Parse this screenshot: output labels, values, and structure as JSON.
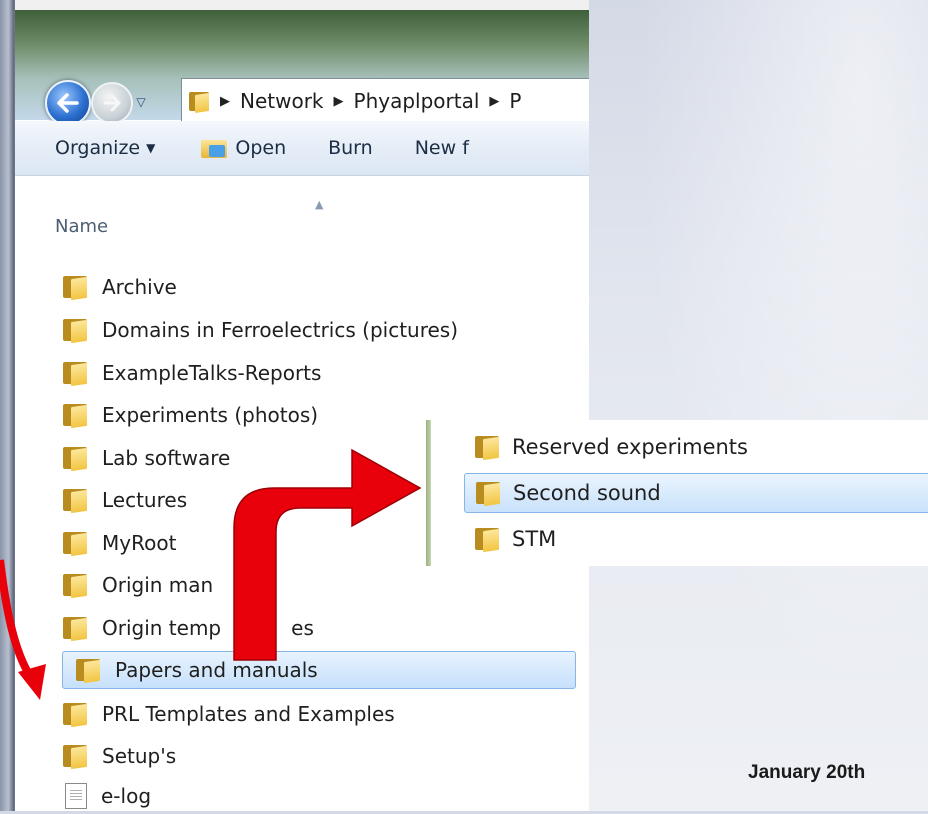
{
  "address_bar": {
    "crumbs": [
      "Network",
      "Phyaplportal",
      "P"
    ]
  },
  "toolbar": {
    "organize_label": "Organize",
    "open_label": "Open",
    "burn_label": "Burn",
    "new_label": "New f"
  },
  "column_header": {
    "name_label": "Name"
  },
  "file_list": [
    {
      "label": "Archive",
      "icon": "folder-icon"
    },
    {
      "label": "Domains in Ferroelectrics (pictures)",
      "icon": "folder-icon"
    },
    {
      "label": "ExampleTalks-Reports",
      "icon": "folder-icon"
    },
    {
      "label": "Experiments (photos)",
      "icon": "folder-icon"
    },
    {
      "label": "Lab software",
      "icon": "folder-icon"
    },
    {
      "label": "Lectures",
      "icon": "folder-icon"
    },
    {
      "label": "MyRoot",
      "icon": "folder-icon"
    },
    {
      "label": "Origin man",
      "icon": "folder-icon"
    },
    {
      "label": "Origin temp",
      "icon": "folder-icon",
      "suffix": "es"
    },
    {
      "label": "Papers and manuals",
      "icon": "folder-icon",
      "selected": true
    },
    {
      "label": "PRL Templates and Examples",
      "icon": "folder-icon"
    },
    {
      "label": "Setup's",
      "icon": "folder-icon"
    },
    {
      "label": "e-log",
      "icon": "document-icon"
    }
  ],
  "subfolder_pane": [
    {
      "label": "Reserved experiments",
      "icon": "folder-icon"
    },
    {
      "label": "Second sound",
      "icon": "folder-icon",
      "selected": true
    },
    {
      "label": "STM",
      "icon": "folder-icon"
    }
  ],
  "slide": {
    "date_text": "January 20th"
  },
  "colors": {
    "arrow": "#e8000b",
    "selection": "#c6e0fb",
    "toolbar": "#e5edf7"
  }
}
